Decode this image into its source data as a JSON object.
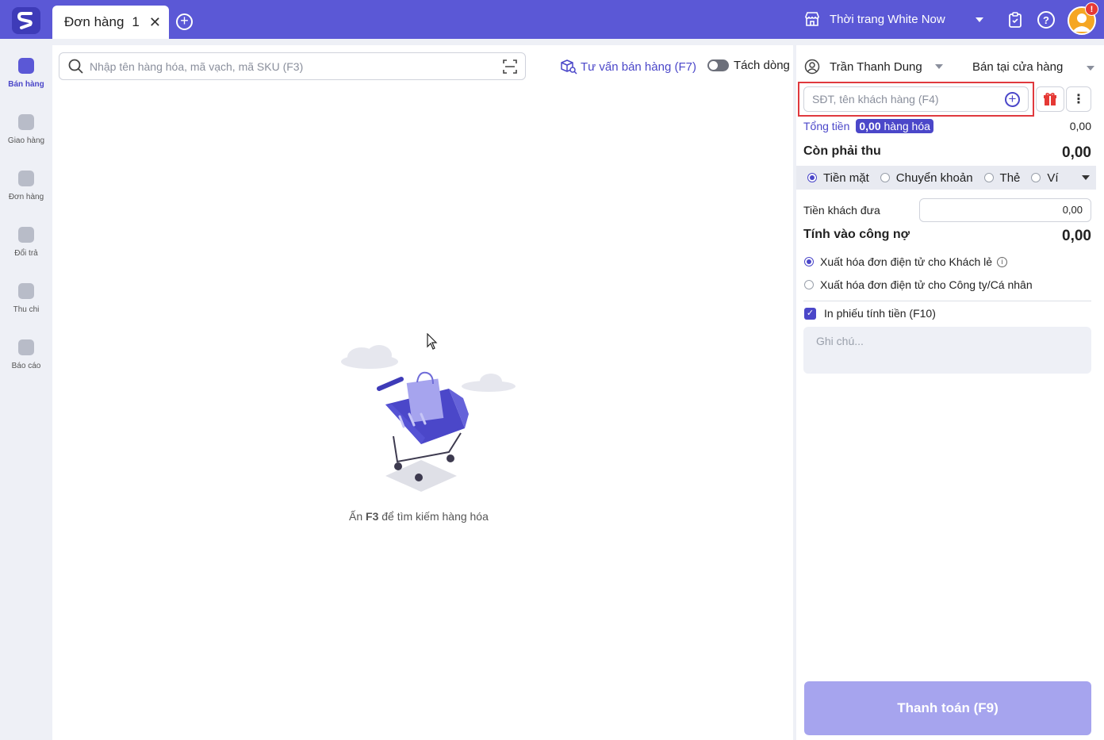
{
  "header": {
    "tab": {
      "label": "Đơn hàng",
      "number": "1"
    },
    "store_name": "Thời trang White Now",
    "notification_count": "!"
  },
  "sidebar": {
    "items": [
      {
        "label": "Bán hàng",
        "icon": "cart-icon",
        "active": true
      },
      {
        "label": "Giao hàng",
        "icon": "truck-icon",
        "active": false
      },
      {
        "label": "Đơn hàng",
        "icon": "document-icon",
        "active": false
      },
      {
        "label": "Đổi trả",
        "icon": "return-icon",
        "active": false
      },
      {
        "label": "Thu chi",
        "icon": "cash-icon",
        "active": false
      },
      {
        "label": "Báo cáo",
        "icon": "chart-icon",
        "active": false
      }
    ]
  },
  "main": {
    "search_placeholder": "Nhập tên hàng hóa, mã vạch, mã SKU (F3)",
    "advisor_label": "Tư vấn bán hàng (F7)",
    "split_label": "Tách dòng",
    "empty": {
      "prefix": "Ấn ",
      "key": "F3",
      "suffix": " để tìm kiếm hàng hóa"
    }
  },
  "order": {
    "staff": "Trần Thanh Dung",
    "channel": "Bán tại cửa hàng",
    "customer_placeholder": "SĐT, tên khách hàng (F4)",
    "total_label": "Tổng tiền",
    "qty_value": "0,00",
    "qty_unit": " hàng hóa",
    "total_value": "0,00",
    "due_label": "Còn phải thu",
    "due_value": "0,00",
    "payment_methods": [
      {
        "label": "Tiền mặt",
        "selected": true
      },
      {
        "label": "Chuyển khoản",
        "selected": false
      },
      {
        "label": "Thẻ",
        "selected": false
      },
      {
        "label": "Ví",
        "selected": false
      }
    ],
    "given_label": "Tiền khách đưa",
    "given_value": "0,00",
    "debt_label": "Tính vào công nợ",
    "debt_value": "0,00",
    "invoice_options": [
      {
        "label": "Xuất hóa đơn điện tử cho Khách lẻ",
        "selected": true,
        "info": true
      },
      {
        "label": "Xuất hóa đơn điện tử cho Công ty/Cá nhân",
        "selected": false,
        "info": false
      }
    ],
    "print_label": "In phiếu tính tiền (F10)",
    "print_checked": true,
    "note_placeholder": "Ghi chú...",
    "pay_button": "Thanh toán (F9)"
  },
  "colors": {
    "brand": "#5b58d6",
    "accent": "#4b47c9",
    "pay_button": "#a6a4ee",
    "highlight": "#e0393e"
  }
}
